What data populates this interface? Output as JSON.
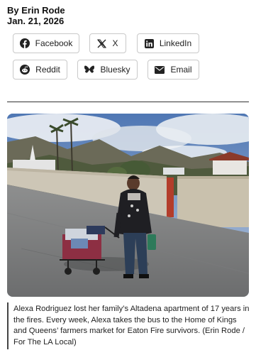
{
  "article": {
    "author_line": "By Erin Rode",
    "date": "Jan. 21, 2026"
  },
  "share": {
    "facebook": "Facebook",
    "x": "X",
    "linkedin": "LinkedIn",
    "reddit": "Reddit",
    "bluesky": "Bluesky",
    "email": "Email"
  },
  "photo": {
    "caption": "Alexa Rodriguez lost her family’s Altadena apartment of 17 years in the fires. Every week, Alexa takes the bus to the Home of Kings and Queens’ farmers market for Eaton Fire survivors. (Erin Rode / For The LA Local)"
  },
  "colors": {
    "facebook": "#1877f2",
    "icon_dark": "#222222",
    "border": "#c9c9c9"
  }
}
